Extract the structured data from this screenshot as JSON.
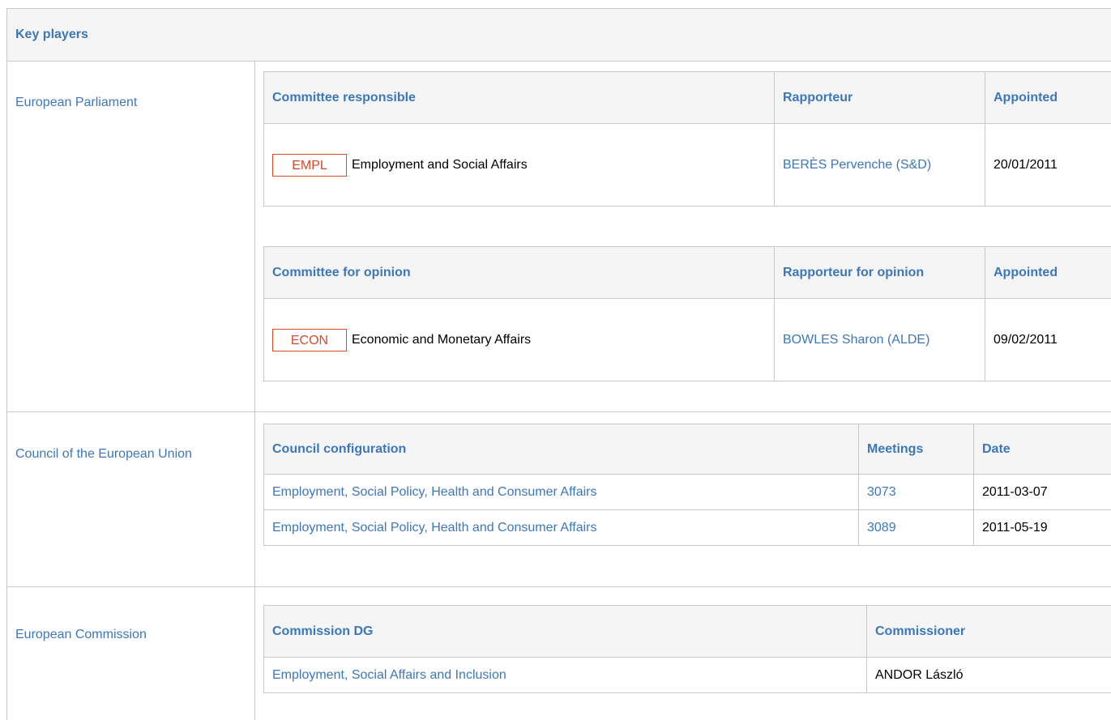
{
  "title": "Key players",
  "ep": {
    "label": "European Parliament",
    "responsible": {
      "headers": [
        "Committee responsible",
        "Rapporteur",
        "Appointed"
      ],
      "code": "EMPL",
      "name": "Employment and Social Affairs",
      "rapporteur": "BERÈS Pervenche (S&D)",
      "appointed": "20/01/2011"
    },
    "opinion": {
      "headers": [
        "Committee for opinion",
        "Rapporteur for opinion",
        "Appointed"
      ],
      "code": "ECON",
      "name": "Economic and Monetary Affairs",
      "rapporteur": "BOWLES Sharon (ALDE)",
      "appointed": "09/02/2011"
    }
  },
  "council": {
    "label": "Council of the European Union",
    "headers": [
      "Council configuration",
      "Meetings",
      "Date"
    ],
    "rows": [
      {
        "config": "Employment, Social Policy, Health and Consumer Affairs",
        "meeting": "3073",
        "date": "2011-03-07"
      },
      {
        "config": "Employment, Social Policy, Health and Consumer Affairs",
        "meeting": "3089",
        "date": "2011-05-19"
      }
    ]
  },
  "commission": {
    "label": "European Commission",
    "headers": [
      "Commission DG",
      "Commissioner"
    ],
    "dg": "Employment, Social Affairs and Inclusion",
    "commissioner": "ANDOR László"
  },
  "colors": {
    "link": "#3d77bb",
    "tag": "#d9482a",
    "border": "#c8c8c8",
    "header_bg": "#f5f5f5"
  }
}
